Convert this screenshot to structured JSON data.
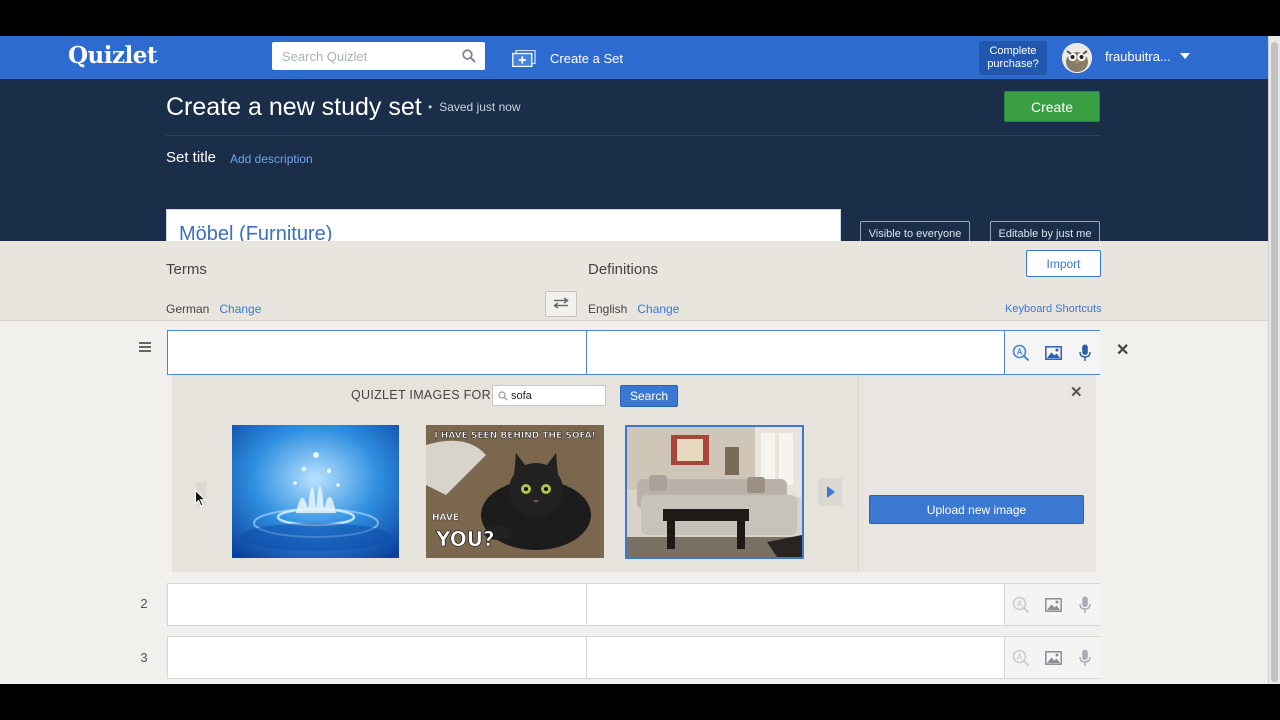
{
  "nav": {
    "logo": "Quizlet",
    "search_placeholder": "Search Quizlet",
    "create_set": "Create a Set",
    "complete_purchase": "Complete purchase?",
    "username": "fraubuitra..."
  },
  "header": {
    "title": "Create a new study set",
    "saved_status": "Saved just now",
    "create_button": "Create",
    "set_title_label": "Set title",
    "add_description": "Add description",
    "set_title_value": "Möbel (Furniture)",
    "visibility_button": "Visible to everyone",
    "editable_button": "Editable by just me"
  },
  "terms_header": {
    "terms_label": "Terms",
    "definitions_label": "Definitions",
    "term_language": "German",
    "definition_language": "English",
    "change_label": "Change",
    "import_button": "Import",
    "keyboard_shortcuts": "Keyboard Shortcuts"
  },
  "image_picker": {
    "label": "QUIZLET IMAGES FOR",
    "query": "sofa",
    "search_button": "Search",
    "upload_button": "Upload new image",
    "meme_top_text": "I HAVE SEEN BEHIND THE SOFA!",
    "meme_mid_text": "HAVE",
    "meme_bottom_text": "YOU?",
    "images": [
      "water-splash",
      "kitten-meme",
      "living-room-sofa"
    ],
    "selected_index": 2
  },
  "rows": [
    {
      "number": "",
      "term": "",
      "definition": ""
    },
    {
      "number": "2",
      "term": "",
      "definition": ""
    },
    {
      "number": "3",
      "term": "",
      "definition": ""
    }
  ],
  "colors": {
    "nav_blue": "#2d6bd0",
    "header_navy": "#1a2e49",
    "create_green": "#3a9e43",
    "accent_blue": "#3b78d1"
  }
}
